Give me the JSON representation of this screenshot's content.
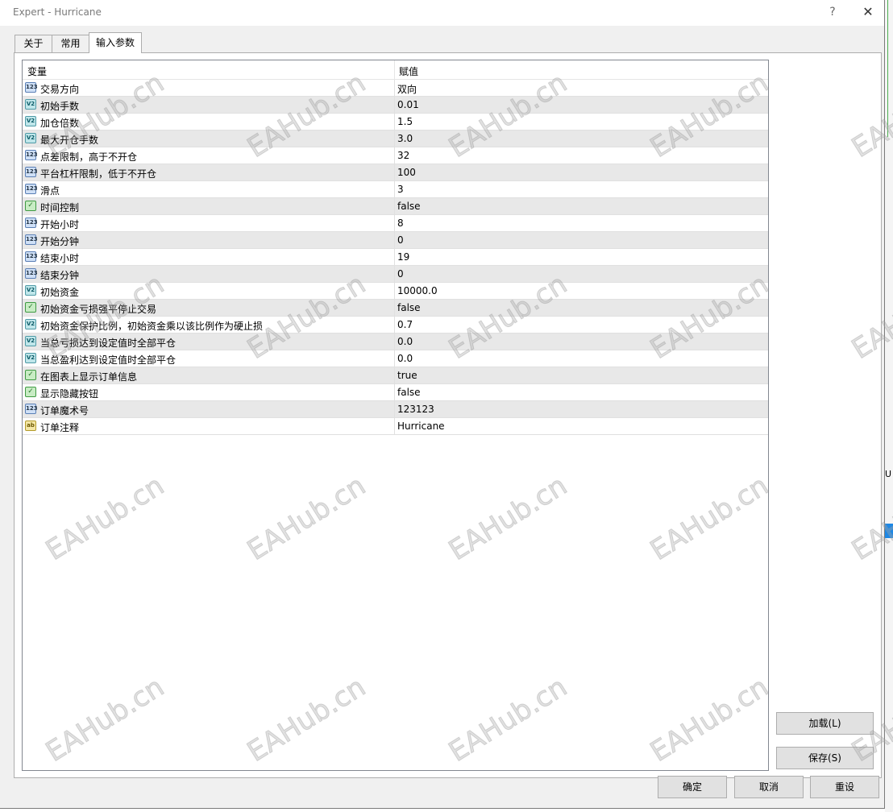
{
  "window": {
    "title": "Expert - Hurricane",
    "help_glyph": "?",
    "close_glyph": "✕"
  },
  "tabs": [
    {
      "label": "关于"
    },
    {
      "label": "常用"
    },
    {
      "label": "输入参数",
      "active": true
    }
  ],
  "table": {
    "columns": {
      "variable": "变量",
      "value": "赋值"
    },
    "rows": [
      {
        "type": "int",
        "name": "交易方向",
        "value": "双向"
      },
      {
        "type": "dbl",
        "name": "初始手数",
        "value": "0.01"
      },
      {
        "type": "dbl",
        "name": "加仓倍数",
        "value": "1.5"
      },
      {
        "type": "dbl",
        "name": "最大开仓手数",
        "value": "3.0"
      },
      {
        "type": "int",
        "name": "点差限制，高于不开仓",
        "value": "32"
      },
      {
        "type": "int",
        "name": "平台杠杆限制，低于不开仓",
        "value": "100"
      },
      {
        "type": "int",
        "name": "滑点",
        "value": "3"
      },
      {
        "type": "bool",
        "name": "时间控制",
        "value": "false"
      },
      {
        "type": "int",
        "name": "开始小时",
        "value": "8"
      },
      {
        "type": "int",
        "name": "开始分钟",
        "value": "0"
      },
      {
        "type": "int",
        "name": "结束小时",
        "value": "19"
      },
      {
        "type": "int",
        "name": "结束分钟",
        "value": "0"
      },
      {
        "type": "dbl",
        "name": "初始资金",
        "value": "10000.0"
      },
      {
        "type": "bool",
        "name": "初始资金亏损强平停止交易",
        "value": "false"
      },
      {
        "type": "dbl",
        "name": "初始资金保护比例，初始资金乘以该比例作为硬止损",
        "value": "0.7"
      },
      {
        "type": "dbl",
        "name": "当总亏损达到设定值时全部平仓",
        "value": "0.0"
      },
      {
        "type": "dbl",
        "name": "当总盈利达到设定值时全部平仓",
        "value": "0.0"
      },
      {
        "type": "bool",
        "name": "在图表上显示订单信息",
        "value": "true"
      },
      {
        "type": "bool",
        "name": "显示隐藏按钮",
        "value": "false"
      },
      {
        "type": "int",
        "name": "订单魔术号",
        "value": "123123"
      },
      {
        "type": "str",
        "name": "订单注释",
        "value": "Hurricane"
      }
    ]
  },
  "icon_glyphs": {
    "int": "123",
    "dbl": "V2",
    "bool": "✓",
    "str": "ab"
  },
  "side_buttons": {
    "load": "加载(L)",
    "save": "保存(S)"
  },
  "bottom_buttons": {
    "ok": "确定",
    "cancel": "取消",
    "reset": "重设"
  },
  "watermark": "EAHub.cn",
  "background": {
    "right_edge_text": "U"
  }
}
